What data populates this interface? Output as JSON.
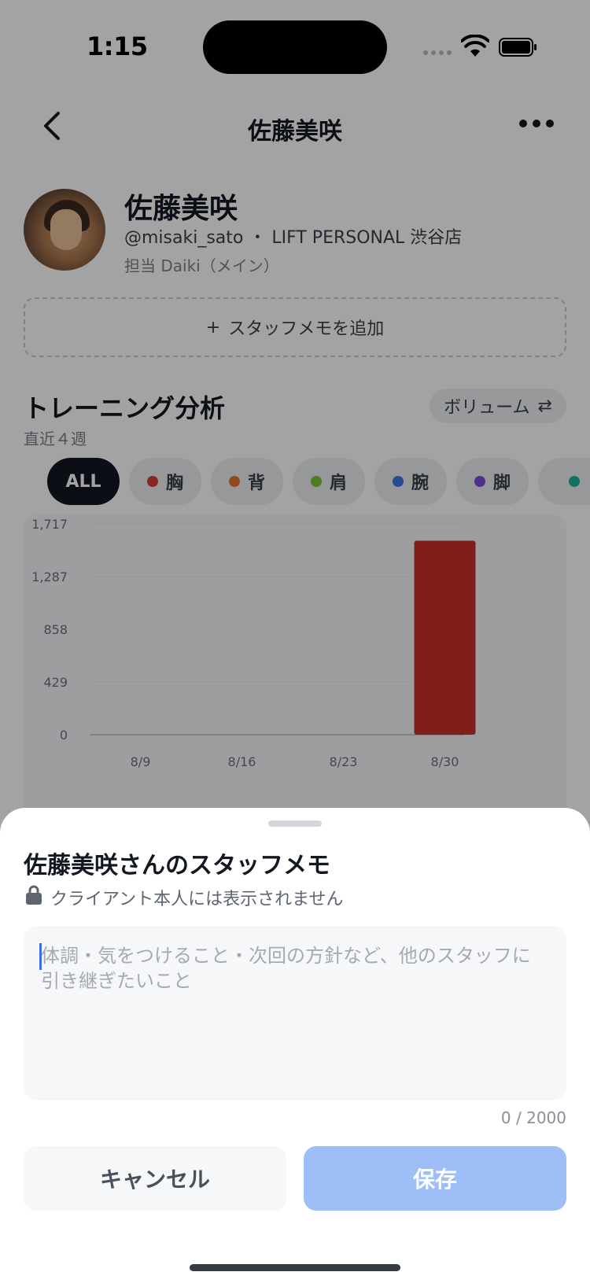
{
  "status_bar": {
    "time": "1:15"
  },
  "nav": {
    "title": "佐藤美咲"
  },
  "profile": {
    "name": "佐藤美咲",
    "meta": "@misaki_sato ・ LIFT PERSONAL 渋谷店",
    "coach": "担当 Daiki（メイン）"
  },
  "add_memo": {
    "icon": "+",
    "label": "スタッフメモを追加"
  },
  "analysis": {
    "title": "トレーニング分析",
    "subtitle": "直近４週",
    "mode_label": "ボリューム",
    "mode_icon": "⇄",
    "chips": [
      {
        "label": "ALL",
        "color": null,
        "active": true
      },
      {
        "label": "胸",
        "color": "#d83a3a",
        "active": false
      },
      {
        "label": "背",
        "color": "#e0782a",
        "active": false
      },
      {
        "label": "肩",
        "color": "#7ac42e",
        "active": false
      },
      {
        "label": "腕",
        "color": "#3a78e0",
        "active": false
      },
      {
        "label": "脚",
        "color": "#7b4fd8",
        "active": false
      },
      {
        "label": "",
        "color": "#19b3a0",
        "active": false
      }
    ]
  },
  "chart_data": {
    "type": "bar",
    "categories": [
      "8/9",
      "8/16",
      "8/23",
      "8/30"
    ],
    "series": [
      {
        "values": [
          0,
          0,
          0,
          1580
        ],
        "color": "#c9302c"
      }
    ],
    "y_ticks": [
      "0",
      "429",
      "858",
      "1,287",
      "1,717"
    ],
    "ylim": [
      0,
      1717
    ],
    "xlabel": "",
    "ylabel": "",
    "grid": true
  },
  "sheet": {
    "title": "佐藤美咲さんのスタッフメモ",
    "note": "クライアント本人には表示されません",
    "placeholder": "体調・気をつけること・次回の方針など、他のスタッフに引き継ぎたいこと",
    "value": "",
    "char_count": "0 / 2000",
    "cancel_label": "キャンセル",
    "save_label": "保存"
  }
}
